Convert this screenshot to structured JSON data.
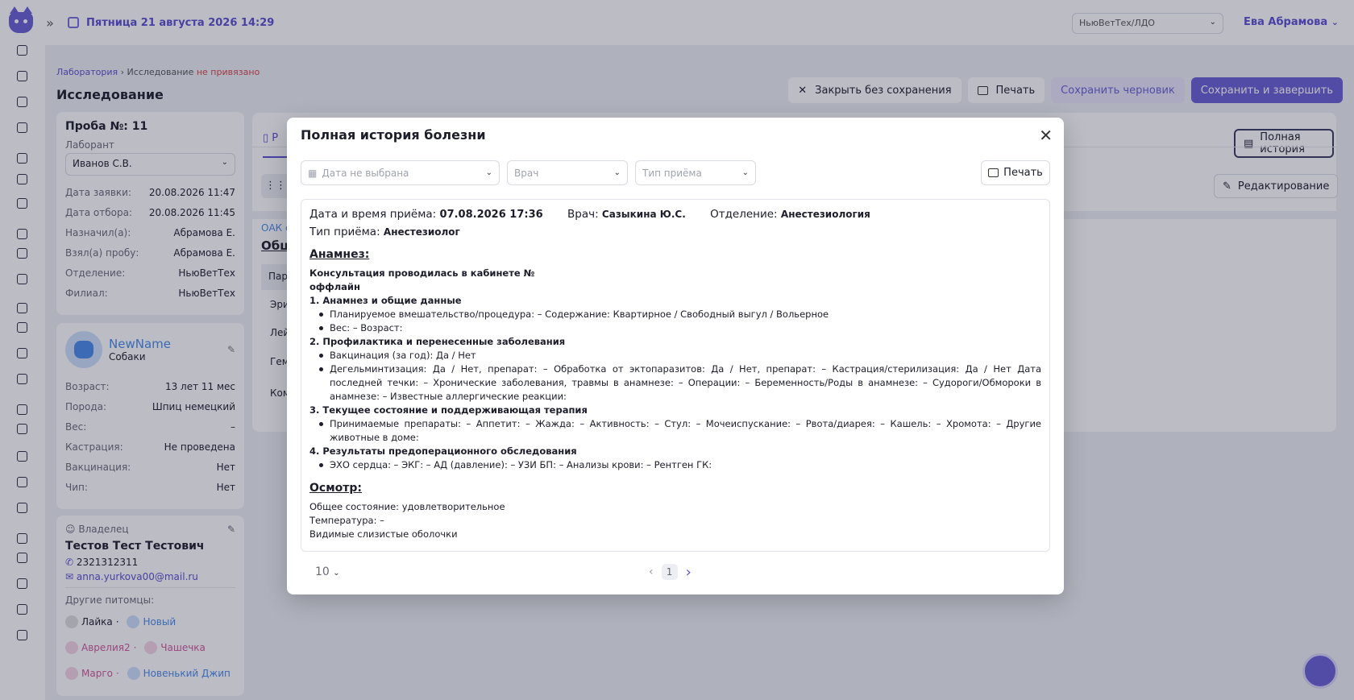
{
  "topbar": {
    "datetime": "Пятница 21 августа 2026 14:29",
    "org": "НьюВетТех/ЛДО",
    "user": "Ева Абрамова"
  },
  "breadcrumb": {
    "lab": "Лаборатория",
    "sep": "›",
    "study": "Исследование",
    "status": "не привязано"
  },
  "page": {
    "title": "Исследование",
    "actions": {
      "close": "Закрыть без сохранения",
      "print": "Печать",
      "draft": "Сохранить черновик",
      "save": "Сохранить и завершить"
    }
  },
  "sample": {
    "title": "Проба №: 11",
    "lab_label": "Лаборант",
    "lab_value": "Иванов С.В.",
    "rows": [
      {
        "k": "Дата заявки:",
        "v": "20.08.2026 11:47"
      },
      {
        "k": "Дата отбора:",
        "v": "20.08.2026 11:45"
      },
      {
        "k": "Назначил(а):",
        "v": "Абрамова Е."
      },
      {
        "k": "Взял(а) пробу:",
        "v": "Абрамова Е."
      },
      {
        "k": "Отделение:",
        "v": "НьюВетТех"
      },
      {
        "k": "Филиал:",
        "v": "НьюВетТех"
      }
    ]
  },
  "pet": {
    "name": "NewName",
    "species": "Собаки",
    "rows": [
      {
        "k": "Возраст:",
        "v": "13 лет 11 мес"
      },
      {
        "k": "Порода:",
        "v": "Шпиц немецкий"
      },
      {
        "k": "Вес:",
        "v": "–"
      },
      {
        "k": "Кастрация:",
        "v": "Не проведена"
      },
      {
        "k": "Вакцинация:",
        "v": "Нет"
      },
      {
        "k": "Чип:",
        "v": "Нет"
      }
    ]
  },
  "owner": {
    "label": "Владелец",
    "name": "Тестов Тест Тестович",
    "phone": "2321312311",
    "email": "anna.yurkova00@mail.ru",
    "other_label": "Другие питомцы:",
    "pets": [
      "Лайка",
      "Новый",
      "Аврелия2",
      "Чашечка",
      "Марго",
      "Новенький Джип"
    ]
  },
  "right_panel": {
    "full_history": "Полная история",
    "edit": "Редактирование",
    "tab_partial": "Р",
    "oak_partial": "ОАК с",
    "section_partial": "Общ",
    "col_partial": "Пар",
    "rows_partial": [
      "Эри",
      "Лей",
      "Гем"
    ],
    "comment_partial": "Ком"
  },
  "modal": {
    "title": "Полная история болезни",
    "filters": {
      "date_placeholder": "Дата не выбрана",
      "doctor_placeholder": "Врач",
      "type_placeholder": "Тип приёма"
    },
    "print": "Печать",
    "record": {
      "dt_label": "Дата и время приёма:",
      "dt_value": "07.08.2026 17:36",
      "doctor_label": "Врач:",
      "doctor_value": "Сазыкина Ю.С.",
      "dept_label": "Отделение:",
      "dept_value": "Анестезиология",
      "type_label": "Тип приёма:",
      "type_value": "Анестезиолог",
      "anamnesis_h": "Анамнез:",
      "l1": "Консультация проводилась в кабинете №",
      "l2": "оффлайн",
      "s1": "1. Анамнез и общие данные",
      "s1b1": "Планируемое вмешательство/процедура: – Содержание: Квартирное / Свободный выгул / Вольерное",
      "s1b2": "Вес: – Возраст:",
      "s2": "2. Профилактика и перенесенные заболевания",
      "s2b1": "Вакцинация (за год): Да / Нет",
      "s2b2": "Дегельминтизация: Да / Нет, препарат: – Обработка от эктопаразитов: Да / Нет, препарат: – Кастрация/стерилизация: Да / Нет Дата последней течки: – Хронические заболевания, травмы в анамнезе: – Операции: – Беременность/Роды в анамнезе: – Судороги/Обмороки в анамнезе: – Известные аллергические реакции:",
      "s3": "3. Текущее состояние и поддерживающая терапия",
      "s3b1": "Принимаемые препараты: – Аппетит: – Жажда: – Активность: – Стул: – Мочеиспускание: – Рвота/диарея: – Кашель: – Хромота: – Другие животные в доме:",
      "s4": "4. Результаты предоперационного обследования",
      "s4b1": "ЭХО сердца: – ЭКГ: – АД (давление): – УЗИ БП: – Анализы крови: – Рентген ГК:",
      "exam_h": "Осмотр:",
      "e1": "Общее состояние: удовлетворительное",
      "e2": "Температура: –",
      "e3": "Видимые слизистые оболочки"
    },
    "footer": {
      "page_size": "10",
      "current_page": "1"
    }
  }
}
